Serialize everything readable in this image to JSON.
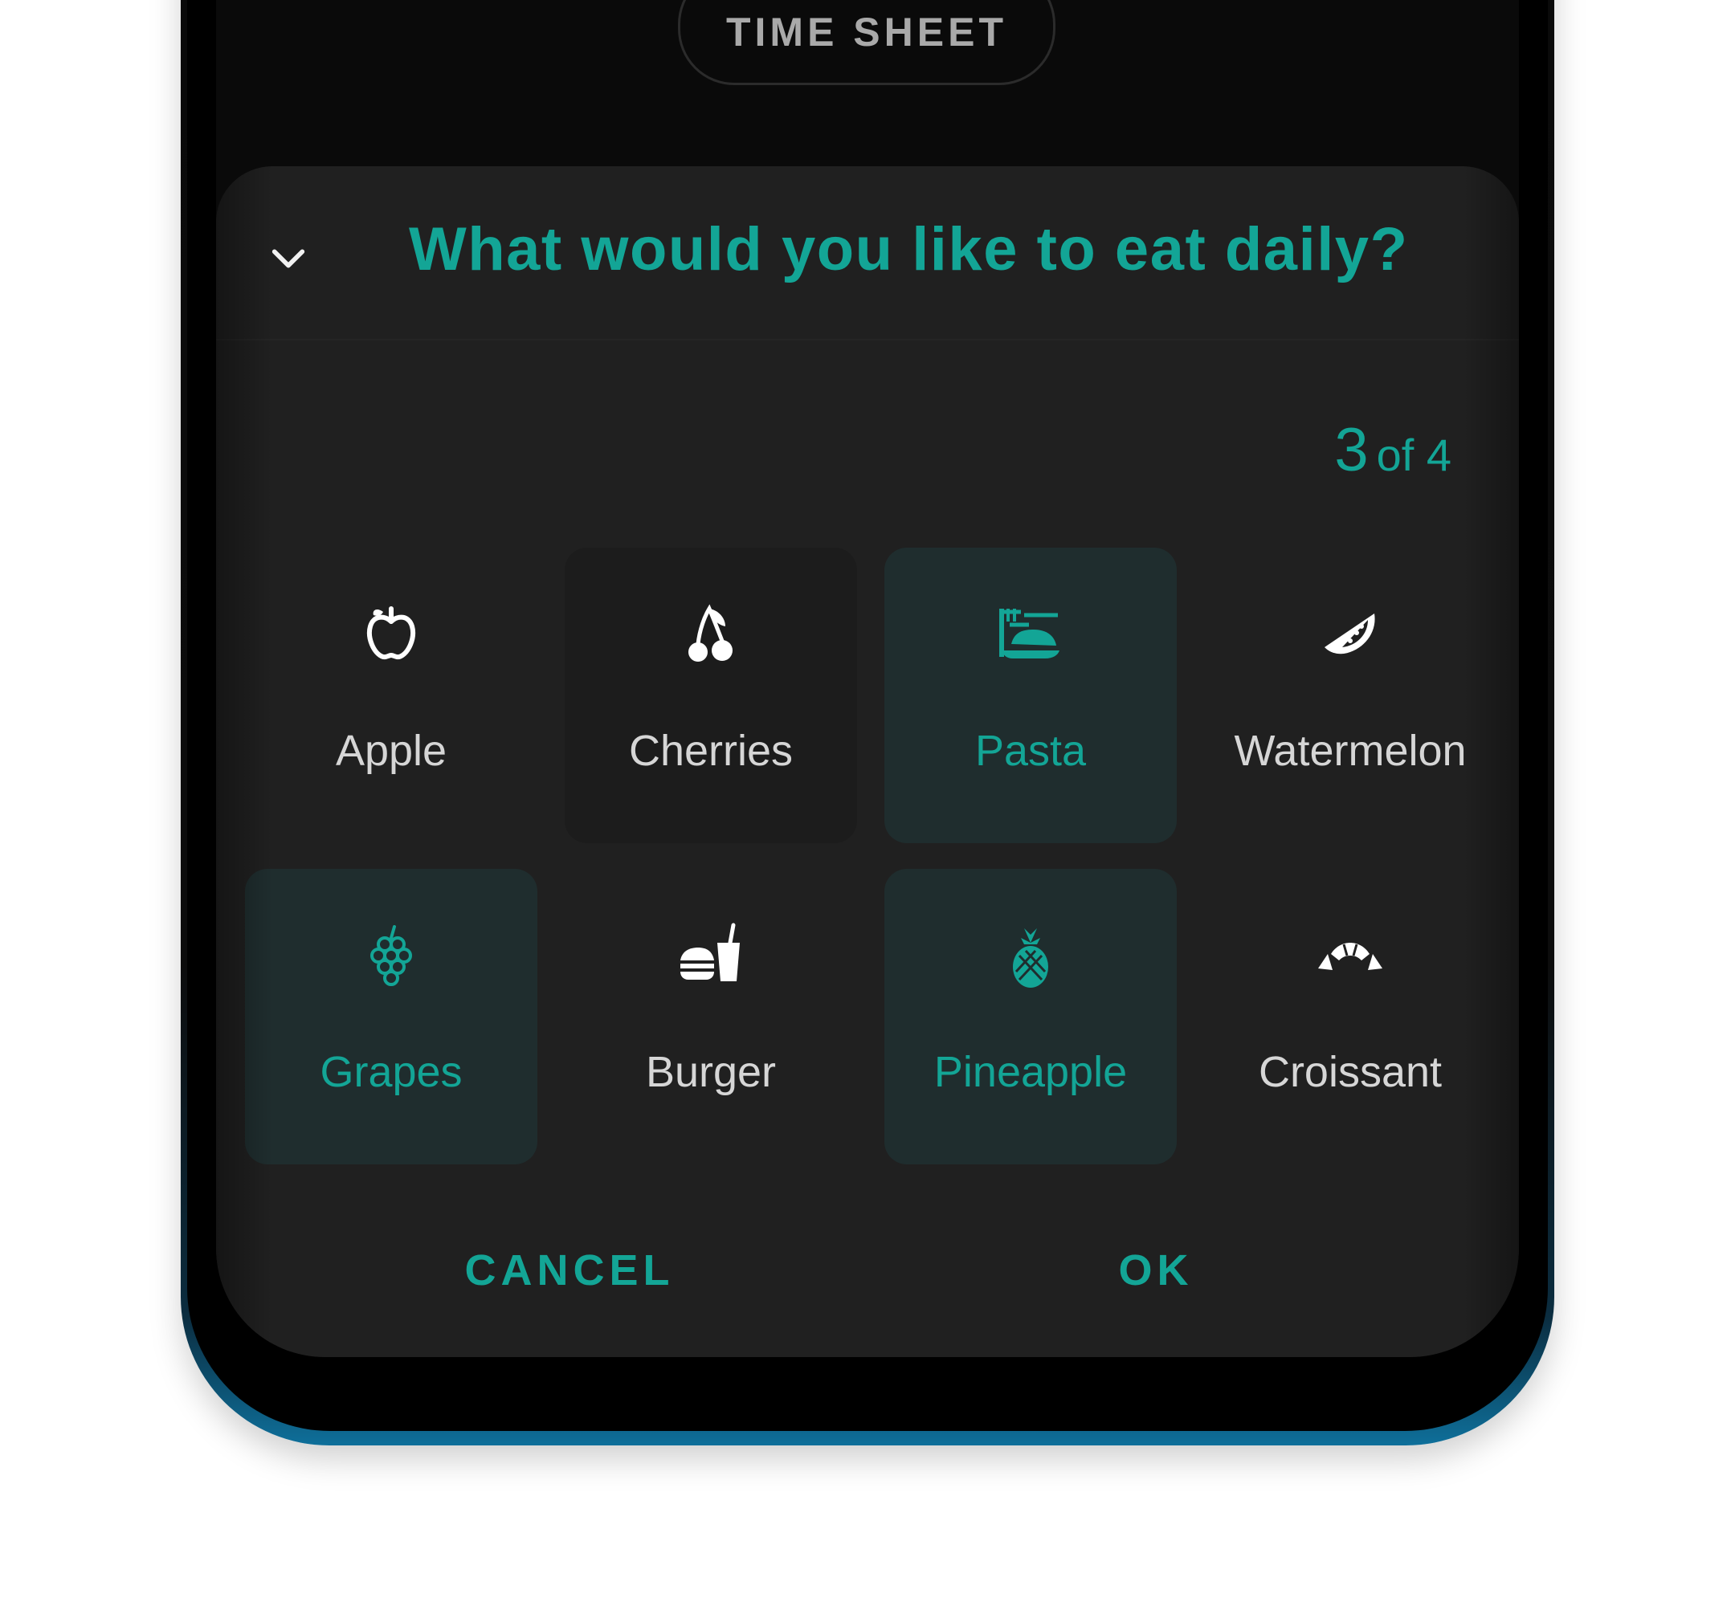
{
  "status_pill": {
    "label": "TIME SHEET"
  },
  "dialog": {
    "title": "What would you like to eat daily?",
    "counter": {
      "current": "3",
      "of_total": "of 4"
    },
    "items": [
      {
        "label": "Apple",
        "icon": "apple-icon",
        "selected": false
      },
      {
        "label": "Cherries",
        "icon": "cherries-icon",
        "selected": false
      },
      {
        "label": "Pasta",
        "icon": "pasta-icon",
        "selected": true
      },
      {
        "label": "Watermelon",
        "icon": "watermelon-icon",
        "selected": false
      },
      {
        "label": "Grapes",
        "icon": "grapes-icon",
        "selected": true
      },
      {
        "label": "Burger",
        "icon": "burger-drink-icon",
        "selected": false
      },
      {
        "label": "Pineapple",
        "icon": "pineapple-icon",
        "selected": true
      },
      {
        "label": "Croissant",
        "icon": "croissant-icon",
        "selected": false
      }
    ],
    "cancel_label": "CANCEL",
    "ok_label": "OK"
  },
  "colors": {
    "accent": "#13a596",
    "sheet_bg": "#202020",
    "selected_bg": "#1f2d2e",
    "text": "#d6d6d6"
  }
}
